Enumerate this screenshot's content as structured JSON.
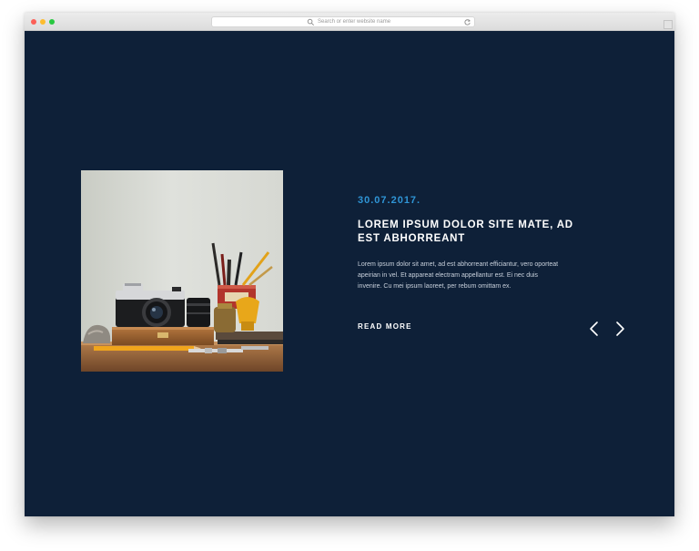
{
  "browser": {
    "address_bar": {
      "placeholder": "Search or enter website name"
    },
    "colors": {
      "close": "#fc5f57",
      "minimize": "#fdbc2e",
      "zoom": "#28c840"
    }
  },
  "slider": {
    "background_color": "#0e2038",
    "accent_color": "#2f95d6",
    "date": "30.07.2017.",
    "title": "LOREM IPSUM DOLOR SITE MATE, AD EST ABHORREANT",
    "excerpt": "Lorem ipsum dolor sit amet, ad est abhorreant efficiantur, vero oporteat apeirian in vel. Et appareat electram appellantur est. Ei nec duis invenire. Cu mei ipsum laoreet, per rebum omittam ex.",
    "read_more_label": "READ MORE",
    "prev_icon": "chevron-left-icon",
    "next_icon": "chevron-right-icon",
    "image": "camera-still-life-photo"
  }
}
